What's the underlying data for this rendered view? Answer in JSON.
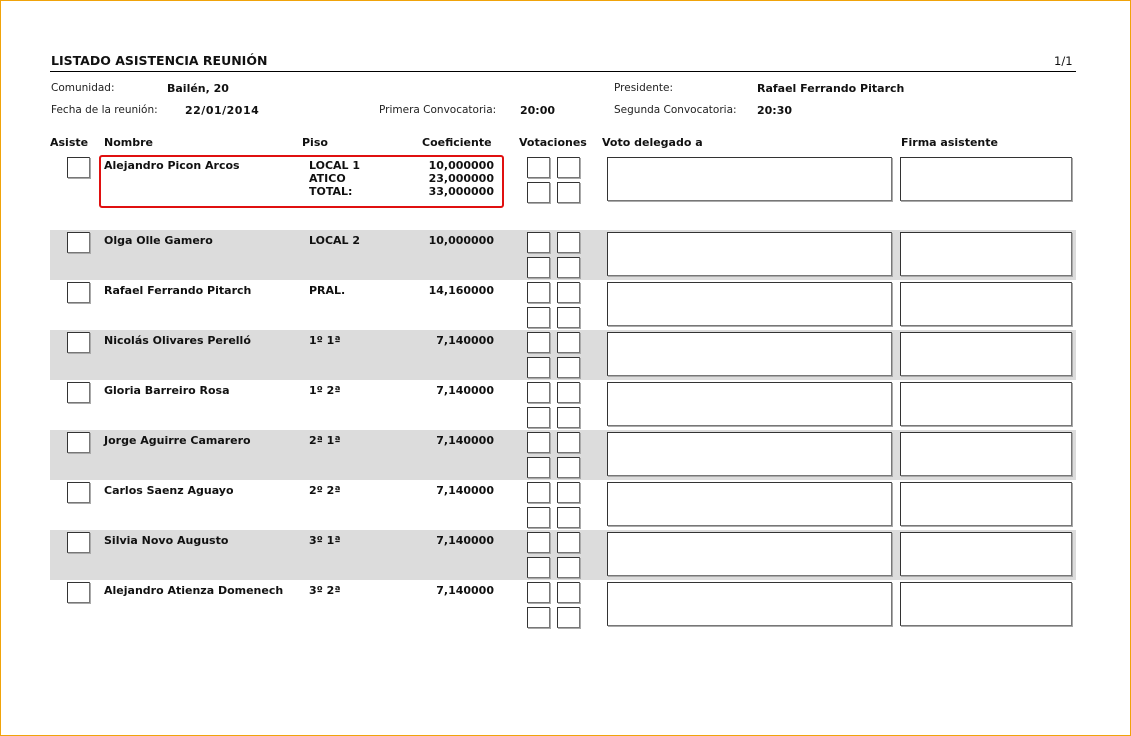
{
  "header": {
    "title": "LISTADO ASISTENCIA REUNIÓN",
    "page": "1/1",
    "comunidad_label": "Comunidad:",
    "comunidad": "Bailén, 20",
    "presidente_label": "Presidente:",
    "presidente": "Rafael Ferrando Pitarch",
    "fecha_label": "Fecha de la reunión:",
    "fecha": "22/01/2014",
    "primera_label": "Primera Convocatoria:",
    "primera": "20:00",
    "segunda_label": "Segunda Convocatoria:",
    "segunda": "20:30"
  },
  "columns": {
    "asiste": "Asiste",
    "nombre": "Nombre",
    "piso": "Piso",
    "coeficiente": "Coeficiente",
    "votaciones": "Votaciones",
    "voto_delegado": "Voto delegado a",
    "firma": "Firma asistente"
  },
  "rows": [
    {
      "nombre": "Alejandro Picon Arcos",
      "piso": [
        "LOCAL 1",
        "ATICO",
        "TOTAL:"
      ],
      "coeficiente": [
        "10,000000",
        "23,000000",
        "33,000000"
      ],
      "highlighted": true
    },
    {
      "nombre": "Olga Olle Gamero",
      "piso": [
        "LOCAL 2"
      ],
      "coeficiente": [
        "10,000000"
      ]
    },
    {
      "nombre": "Rafael Ferrando Pitarch",
      "piso": [
        "PRAL."
      ],
      "coeficiente": [
        "14,160000"
      ]
    },
    {
      "nombre": "Nicolás Olivares Perelló",
      "piso": [
        "1º 1ª"
      ],
      "coeficiente": [
        "7,140000"
      ]
    },
    {
      "nombre": "Gloria Barreiro Rosa",
      "piso": [
        "1º 2ª"
      ],
      "coeficiente": [
        "7,140000"
      ]
    },
    {
      "nombre": "Jorge Aguirre Camarero",
      "piso": [
        "2ª 1ª"
      ],
      "coeficiente": [
        "7,140000"
      ]
    },
    {
      "nombre": "Carlos Saenz Aguayo",
      "piso": [
        "2º 2ª"
      ],
      "coeficiente": [
        "7,140000"
      ]
    },
    {
      "nombre": "Silvia Novo Augusto",
      "piso": [
        "3º 1ª"
      ],
      "coeficiente": [
        "7,140000"
      ]
    },
    {
      "nombre": "Alejandro Atienza Domenech",
      "piso": [
        "3º 2ª"
      ],
      "coeficiente": [
        "7,140000"
      ]
    }
  ],
  "colors": {
    "highlight": "#e01010",
    "row_alt": "#dcdcdc",
    "frame": "#f0a30a"
  }
}
